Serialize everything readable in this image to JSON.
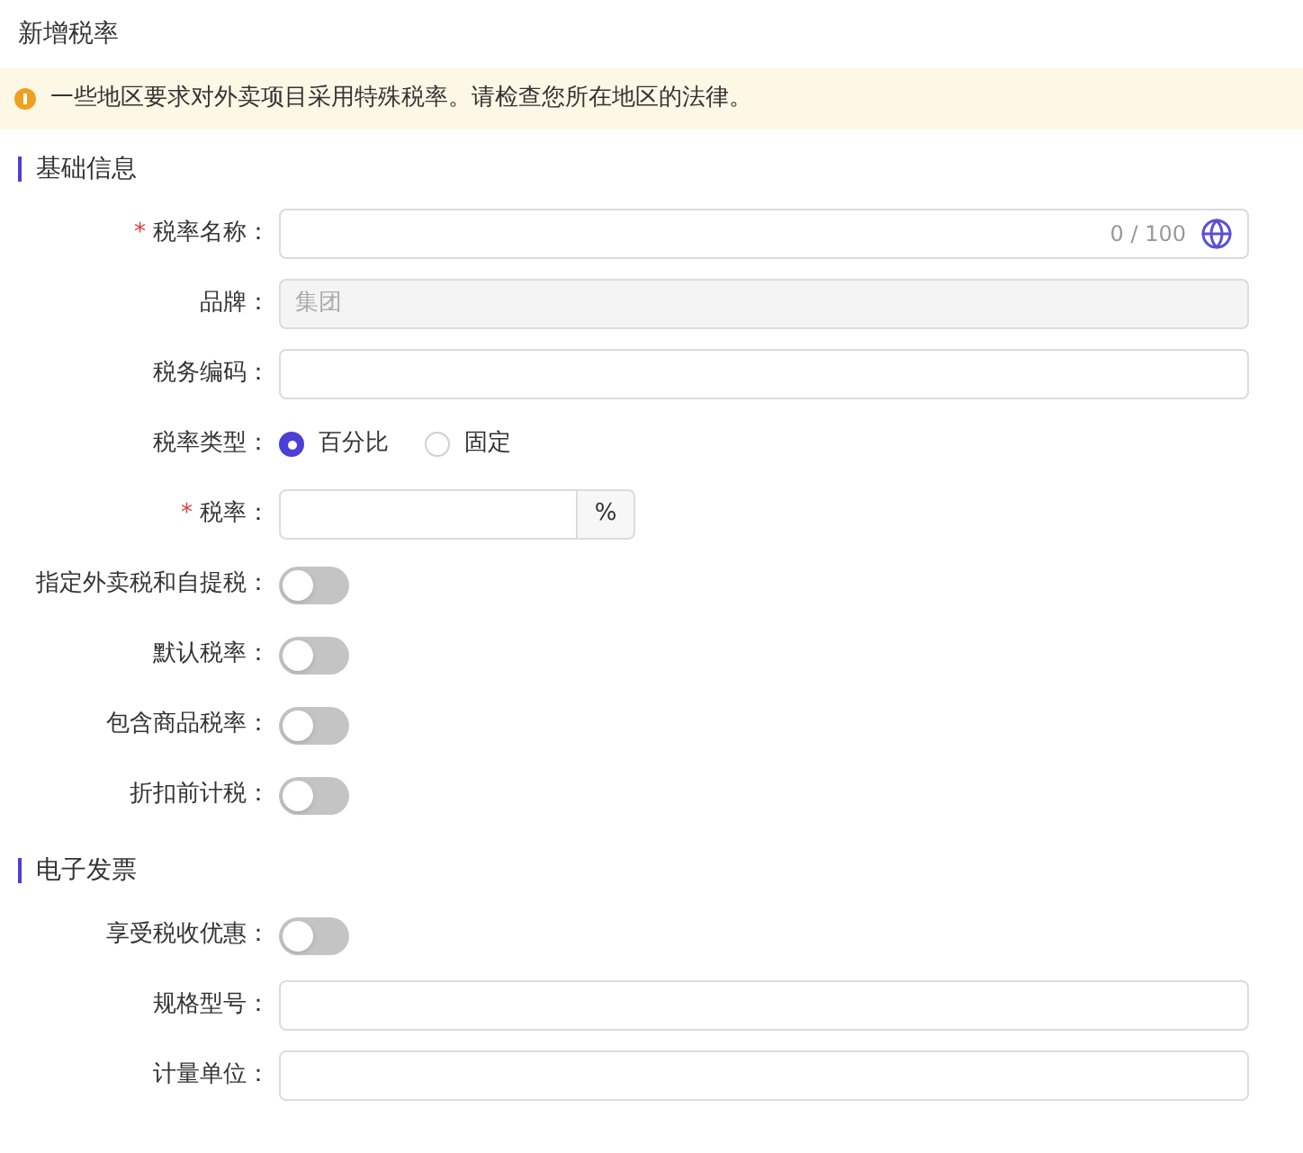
{
  "title": "新增税率",
  "notice": {
    "text": "一些地区要求对外卖项目采用特殊税率。请检查您所在地区的法律。"
  },
  "sections": [
    {
      "title": "基础信息",
      "rows": [
        {
          "kind": "text",
          "label": "税率名称：",
          "required_mark": "*",
          "counter": "0 / 100",
          "globe": true
        },
        {
          "kind": "text",
          "label": "品牌：",
          "value": "集团",
          "disabled": true
        },
        {
          "kind": "text",
          "label": "税务编码："
        },
        {
          "kind": "radio",
          "label": "税率类型：",
          "options": [
            {
              "label": "百分比",
              "selected": true
            },
            {
              "label": "固定",
              "selected": false
            }
          ]
        },
        {
          "kind": "suffix",
          "label": "税率：",
          "required_mark": "*",
          "suffix": "%"
        },
        {
          "kind": "switch",
          "label": "指定外卖税和自提税：",
          "on": false
        },
        {
          "kind": "switch",
          "label": "默认税率：",
          "on": false
        },
        {
          "kind": "switch",
          "label": "包含商品税率：",
          "on": false
        },
        {
          "kind": "switch",
          "label": "折扣前计税：",
          "on": false
        }
      ]
    },
    {
      "title": "电子发票",
      "rows": [
        {
          "kind": "switch",
          "label": "享受税收优惠：",
          "on": false
        },
        {
          "kind": "text",
          "label": "规格型号："
        },
        {
          "kind": "text",
          "label": "计量单位："
        }
      ]
    }
  ]
}
